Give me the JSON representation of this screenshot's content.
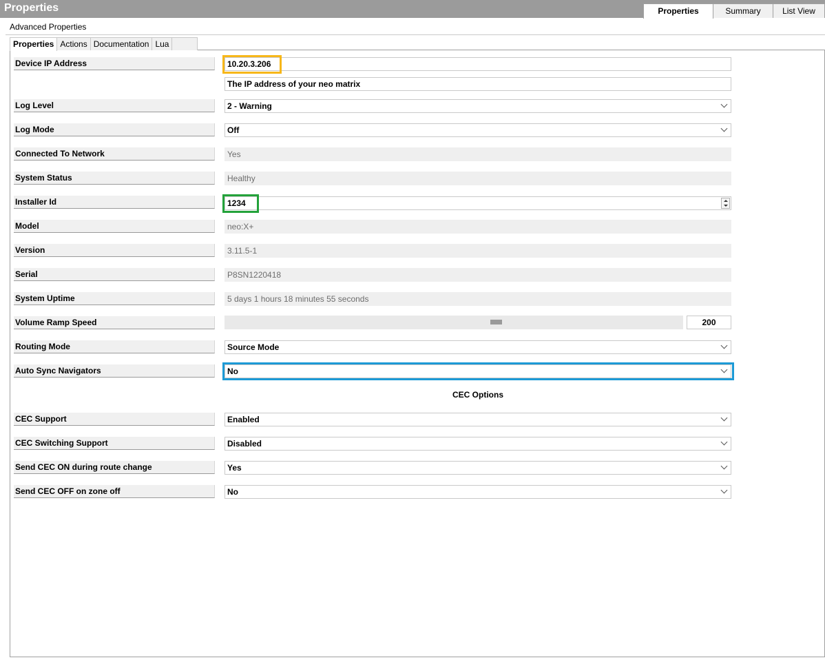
{
  "window": {
    "title": "Properties",
    "tabs": [
      {
        "label": "Properties",
        "active": true
      },
      {
        "label": "Summary",
        "active": false
      },
      {
        "label": "List View",
        "active": false
      }
    ]
  },
  "subheader": "Advanced Properties",
  "inner_tabs": [
    {
      "label": "Properties",
      "active": true
    },
    {
      "label": "Actions",
      "active": false
    },
    {
      "label": "Documentation",
      "active": false
    },
    {
      "label": "Lua",
      "active": false
    }
  ],
  "properties": {
    "device_ip": {
      "label": "Device IP Address",
      "value": "10.20.3.206",
      "description": "The IP address of your neo matrix"
    },
    "log_level": {
      "label": "Log Level",
      "value": "2 - Warning"
    },
    "log_mode": {
      "label": "Log Mode",
      "value": "Off"
    },
    "connected": {
      "label": "Connected To Network",
      "value": "Yes"
    },
    "system_status": {
      "label": "System Status",
      "value": "Healthy"
    },
    "installer_id": {
      "label": "Installer Id",
      "value": "1234"
    },
    "model": {
      "label": "Model",
      "value": "neo:X+"
    },
    "version": {
      "label": "Version",
      "value": "3.11.5-1"
    },
    "serial": {
      "label": "Serial",
      "value": "P8SN1220418"
    },
    "uptime": {
      "label": "System Uptime",
      "value": "5 days 1 hours 18 minutes 55 seconds"
    },
    "volume_ramp": {
      "label": "Volume Ramp Speed",
      "value": "200"
    },
    "routing_mode": {
      "label": "Routing Mode",
      "value": "Source Mode"
    },
    "auto_sync": {
      "label": "Auto Sync Navigators",
      "value": "No"
    }
  },
  "cec": {
    "heading": "CEC Options",
    "cec_support": {
      "label": "CEC Support",
      "value": "Enabled"
    },
    "cec_switching": {
      "label": "CEC Switching Support",
      "value": "Disabled"
    },
    "cec_on_route": {
      "label": "Send CEC ON during route change",
      "value": "Yes"
    },
    "cec_off_zone": {
      "label": "Send CEC OFF on zone off",
      "value": "No"
    }
  },
  "highlights": {
    "yellow": "#f7b719",
    "green": "#23a23a",
    "blue": "#1c9ad6"
  }
}
